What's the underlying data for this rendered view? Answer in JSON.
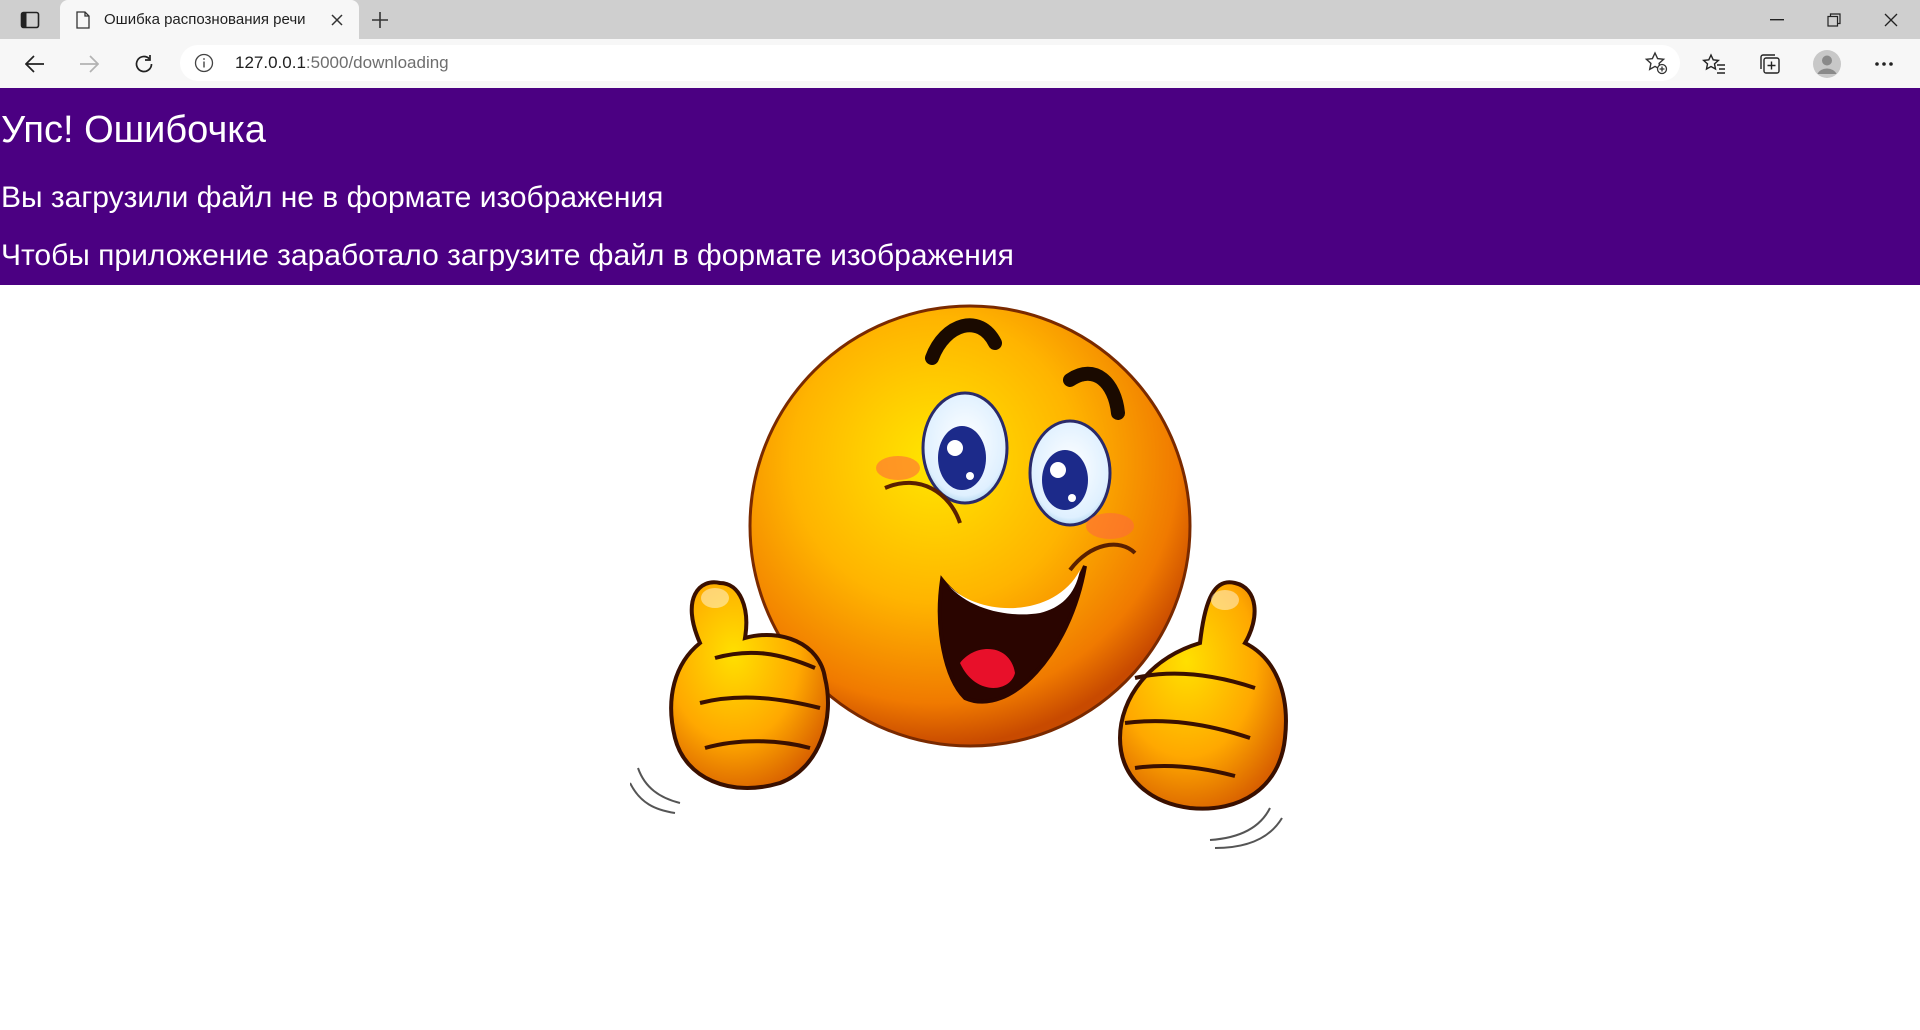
{
  "browser": {
    "tab": {
      "title": "Ошибка распознования речи"
    },
    "address": {
      "host": "127.0.0.1",
      "path": ":5000/downloading"
    }
  },
  "page": {
    "heading": "Упс! Ошибочка",
    "message_1": "Вы загрузили файл не в формате изображения",
    "message_2": "Чтобы приложение заработало загрузите файл в формате изображения"
  },
  "colors": {
    "banner": "#4b0082",
    "banner_text": "#ffffff"
  }
}
